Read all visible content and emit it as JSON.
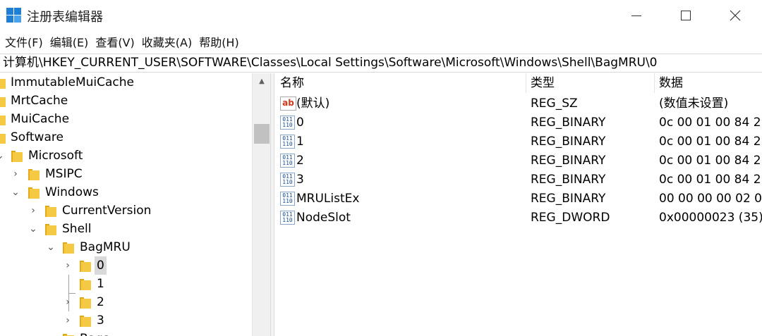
{
  "window": {
    "title": "注册表编辑器",
    "icon": "regedit-icon"
  },
  "menu": [
    "文件(F)",
    "编辑(E)",
    "查看(V)",
    "收藏夹(A)",
    "帮助(H)"
  ],
  "address": "计算机\\HKEY_CURRENT_USER\\SOFTWARE\\Classes\\Local Settings\\Software\\Microsoft\\Windows\\Shell\\BagMRU\\0",
  "tree": [
    {
      "label": "ImmutableMuiCache",
      "expander": ""
    },
    {
      "label": "MrtCache",
      "expander": ""
    },
    {
      "label": "MuiCache",
      "expander": ""
    },
    {
      "label": "Software",
      "expander": ""
    },
    {
      "label": "Microsoft",
      "expander": "expanded"
    },
    {
      "label": "MSIPC",
      "expander": "collapsed"
    },
    {
      "label": "Windows",
      "expander": "expanded"
    },
    {
      "label": "CurrentVersion",
      "expander": "collapsed"
    },
    {
      "label": "Shell",
      "expander": "expanded"
    },
    {
      "label": "BagMRU",
      "expander": "expanded"
    },
    {
      "label": "0",
      "expander": "collapsed",
      "selected": true
    },
    {
      "label": "1",
      "expander": ""
    },
    {
      "label": "2",
      "expander": "collapsed"
    },
    {
      "label": "3",
      "expander": "collapsed"
    },
    {
      "label": "Bags",
      "expander": ""
    }
  ],
  "list": {
    "headers": {
      "name": "名称",
      "type": "类型",
      "data": "数据"
    },
    "rows": [
      {
        "icon": "string-value-icon",
        "name": "(默认)",
        "type": "REG_SZ",
        "data": "(数值未设置)"
      },
      {
        "icon": "binary-value-icon",
        "name": "0",
        "type": "REG_BINARY",
        "data": "0c 00 01 00 84 2"
      },
      {
        "icon": "binary-value-icon",
        "name": "1",
        "type": "REG_BINARY",
        "data": "0c 00 01 00 84 2"
      },
      {
        "icon": "binary-value-icon",
        "name": "2",
        "type": "REG_BINARY",
        "data": "0c 00 01 00 84 2"
      },
      {
        "icon": "binary-value-icon",
        "name": "3",
        "type": "REG_BINARY",
        "data": "0c 00 01 00 84 2"
      },
      {
        "icon": "binary-value-icon",
        "name": "MRUListEx",
        "type": "REG_BINARY",
        "data": "00 00 00 00 02 0"
      },
      {
        "icon": "dword-value-icon",
        "name": "NodeSlot",
        "type": "REG_DWORD",
        "data": "0x00000023 (35)"
      }
    ]
  },
  "icon_glyphs": {
    "ab": "ab",
    "bin": "011\n110"
  },
  "colors": {
    "folder": "#f6c944",
    "selection": "#d9d9d9",
    "accent": "#1f7fd4"
  }
}
